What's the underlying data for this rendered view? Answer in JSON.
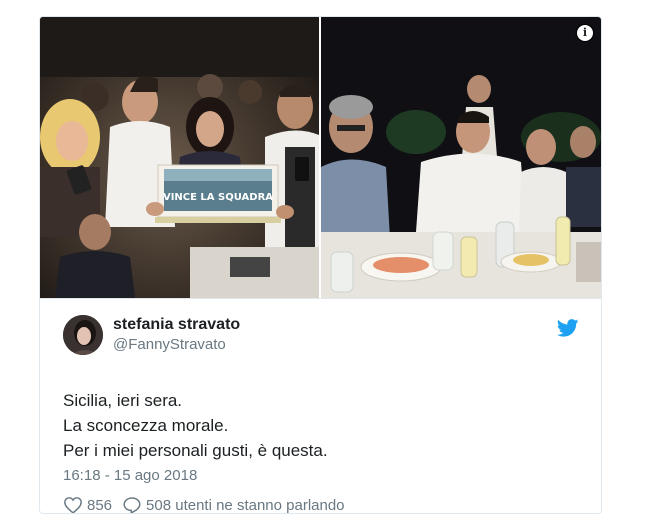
{
  "tweet": {
    "author_name": "stefania stravato",
    "author_handle": "@FannyStravato",
    "text_lines": [
      "Sicilia, ieri sera.",
      "La sconcezza morale.",
      "Per i miei personali gusti, è questa."
    ],
    "timestamp": "16:18 - 15 ago 2018",
    "likes_count": "856",
    "conversation_text": "508 utenti ne stanno parlando"
  },
  "photo_left": {
    "cake_text": "VINCE LA SQUADRA"
  },
  "icons": {
    "info": "info-icon",
    "brand": "twitter-bird-icon",
    "like": "heart-icon",
    "reply": "speech-bubble-icon"
  },
  "colors": {
    "twitter_blue": "#1da1f2",
    "text_dark": "#1c2022",
    "text_muted": "#697882",
    "border": "#e1e8ed"
  }
}
